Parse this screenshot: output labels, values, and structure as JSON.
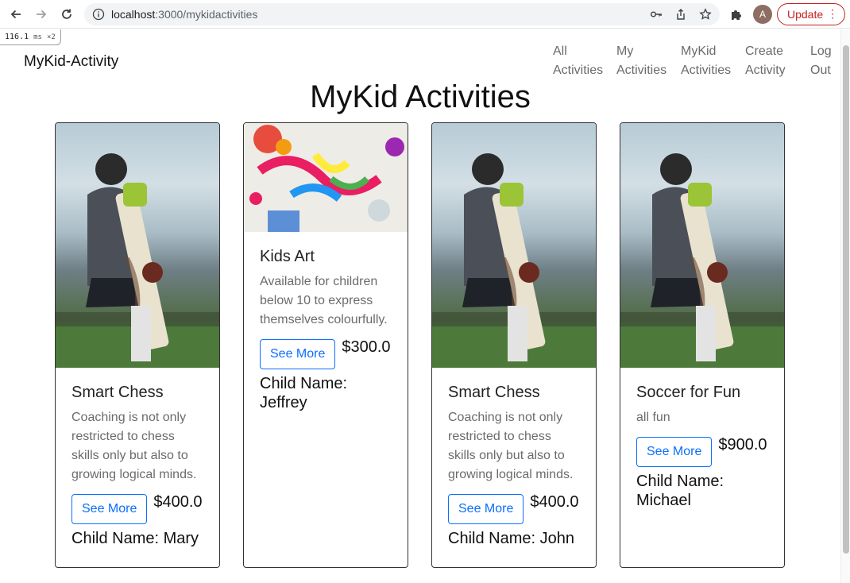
{
  "browser": {
    "url_host": "localhost",
    "url_rest": ":3000/mykidactivities",
    "update_label": "Update",
    "avatar_letter": "A"
  },
  "devtools": {
    "timing_value": "116.1",
    "timing_unit": "ms",
    "timing_mult": "×2"
  },
  "header": {
    "brand": "MyKid-Activity",
    "nav": [
      {
        "line1": "All",
        "line2": "Activities"
      },
      {
        "line1": "My",
        "line2": "Activities"
      },
      {
        "line1": "MyKid",
        "line2": "Activities"
      },
      {
        "line1": "Create",
        "line2": "Activity"
      },
      {
        "line1": "Log",
        "line2": "Out"
      }
    ]
  },
  "page": {
    "title": "MyKid Activities"
  },
  "cards": [
    {
      "title": "Smart Chess",
      "description": "Coaching is not only restricted to chess skills only but also to growing logical minds.",
      "button": "See More",
      "price": "$400.0",
      "child": "Child Name: Mary",
      "image": "cricket-player-photo"
    },
    {
      "title": "Kids Art",
      "description": "Available for children below 10 to express themselves colourfully.",
      "button": "See More",
      "price": "$300.0",
      "child": "Child Name: Jeffrey",
      "image": "kids-painting-photo"
    },
    {
      "title": "Smart Chess",
      "description": "Coaching is not only restricted to chess skills only but also to growing logical minds.",
      "button": "See More",
      "price": "$400.0",
      "child": "Child Name: John",
      "image": "cricket-player-photo"
    },
    {
      "title": "Soccer for Fun",
      "description": "all fun",
      "button": "See More",
      "price": "$900.0",
      "child": "Child Name: Michael",
      "image": "cricket-player-photo"
    }
  ],
  "colors": {
    "primary": "#0d6efd",
    "update": "#c5221f",
    "muted_text": "#6b6b6b"
  }
}
